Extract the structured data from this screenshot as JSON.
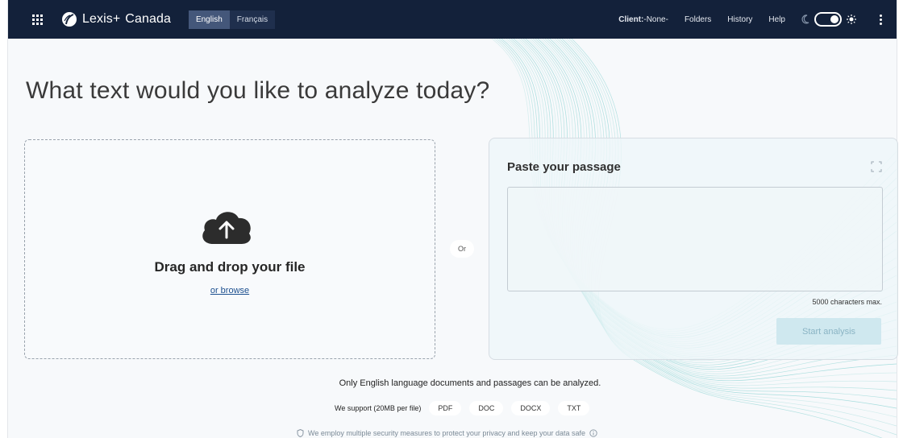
{
  "header": {
    "brand": "Lexis+",
    "brand_region": "Canada",
    "languages": [
      {
        "label": "English",
        "active": true
      },
      {
        "label": "Français",
        "active": false
      }
    ],
    "client_label": "Client:",
    "client_value": "-None-",
    "nav": [
      "Folders",
      "History",
      "Help"
    ],
    "theme_toggle_on": true
  },
  "main": {
    "headline": "What text would you like to analyze today?",
    "upload": {
      "icon": "cloud-upload-icon",
      "title": "Drag and drop your file",
      "browse_link": "or browse"
    },
    "divider": "Or",
    "paste": {
      "title": "Paste your passage",
      "value": "",
      "placeholder": "",
      "char_limit": "5000 characters max.",
      "submit": "Start analysis",
      "submit_enabled": false
    }
  },
  "footer": {
    "language_note": "Only English language documents and passages can be analyzed.",
    "support_label": "We support (20MB per file)",
    "file_types": [
      "PDF",
      "DOC",
      "DOCX",
      "TXT"
    ],
    "security_note": "We employ multiple security measures to protect your privacy and keep your data safe"
  },
  "colors": {
    "header_bg": "#13213a",
    "link": "#1c4f8f",
    "button_disabled_bg": "#cfe8ef",
    "wave": "#39b8b4"
  }
}
